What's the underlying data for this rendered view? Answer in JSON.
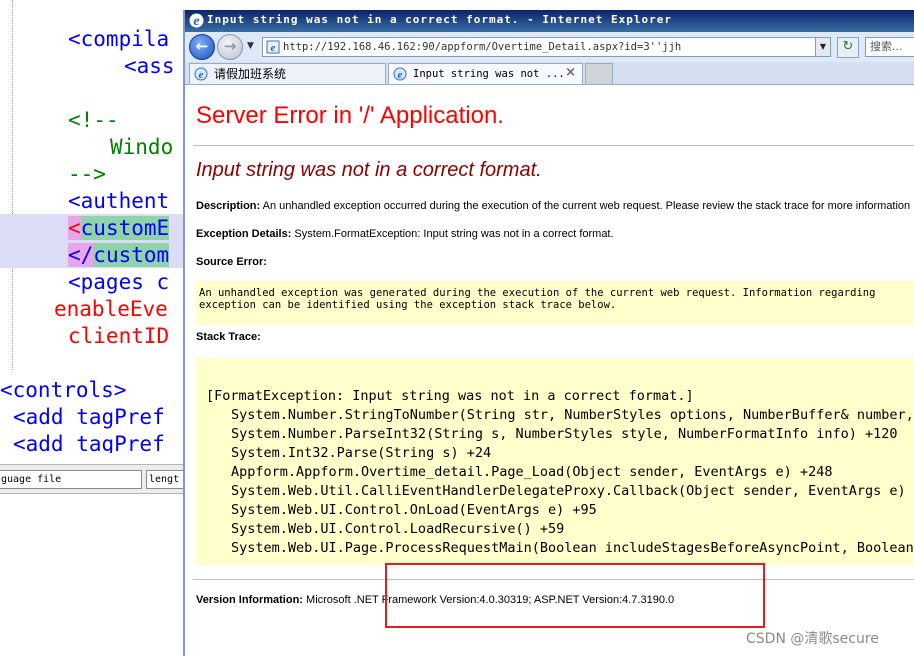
{
  "editor": {
    "lines": [
      {
        "text": "<compila",
        "color": "#0000ff"
      },
      {
        "text": "<ass",
        "color": "#0000ff"
      },
      {
        "text": "<!--",
        "color": "#008000"
      },
      {
        "text": "Windo",
        "color": "#008000"
      },
      {
        "text": "-->",
        "color": "#008000"
      },
      {
        "text": "<authent",
        "color": "#0000ff"
      },
      {
        "text_pre": "<",
        "text": "customE",
        "color": "#0000ff"
      },
      {
        "text_pre": "</",
        "text": "custom",
        "color": "#0000ff"
      },
      {
        "text": "<pages c",
        "color": "#0000ff"
      },
      {
        "text": "enableEve",
        "color": "#ff0000"
      },
      {
        "text": "clientID",
        "color": "#ff0000"
      },
      {
        "text": "<controls>",
        "color": "#0000ff"
      },
      {
        "text": "<add tagPref",
        "color": "#0000ff"
      },
      {
        "text": "<add tagPref",
        "color": "#0000ff"
      }
    ],
    "status": {
      "cell1": "guage file",
      "cell2": "lengt"
    }
  },
  "browser": {
    "window_title": "Input string was not in a correct format. - Internet Explorer",
    "address": "http://192.168.46.162:90/appform/Overtime_Detail.aspx?id=3''jjh",
    "search_placeholder": "搜索...",
    "tabs": [
      {
        "label": "请假加班系统"
      },
      {
        "label": "Input string was not ..."
      }
    ]
  },
  "error_page": {
    "title": "Server Error in '/' Application.",
    "message": "Input string was not in a correct format.",
    "description_label": "Description:",
    "description_text": "An unhandled exception occurred during the execution of the current web request. Please review the stack trace for more information",
    "exception_label": "Exception Details:",
    "exception_text": "System.FormatException: Input string was not in a correct format.",
    "source_error_label": "Source Error:",
    "source_error_line1": "An unhandled exception was generated during the execution of the current web request. Information regarding",
    "source_error_line2": "exception can be identified using the exception stack trace below.",
    "stack_trace_label": "Stack Trace:",
    "stack_trace": [
      "[FormatException: Input string was not in a correct format.]",
      "System.Number.StringToNumber(String str, NumberStyles options, NumberBuffer& number,",
      "System.Number.ParseInt32(String s, NumberStyles style, NumberFormatInfo info) +120",
      "System.Int32.Parse(String s) +24",
      "Appform.Appform.Overtime_detail.Page_Load(Object sender, EventArgs e) +248",
      "System.Web.Util.CalliEventHandlerDelegateProxy.Callback(Object sender, EventArgs e) +",
      "System.Web.UI.Control.OnLoad(EventArgs e) +95",
      "System.Web.UI.Control.LoadRecursive() +59",
      "System.Web.UI.Page.ProcessRequestMain(Boolean includeStagesBeforeAsyncPoint, Boolean"
    ],
    "version_label": "Version Information:",
    "version_text": "Microsoft .NET Framework Version:4.0.30319; ASP.NET Version:4.7.3190.0"
  },
  "watermark": "CSDN @清歌secure",
  "colors": {
    "error_title": "#ff0000",
    "error_message": "#8b0000",
    "highlight_box": "#e02020",
    "code_bg": "#ffffcc"
  }
}
